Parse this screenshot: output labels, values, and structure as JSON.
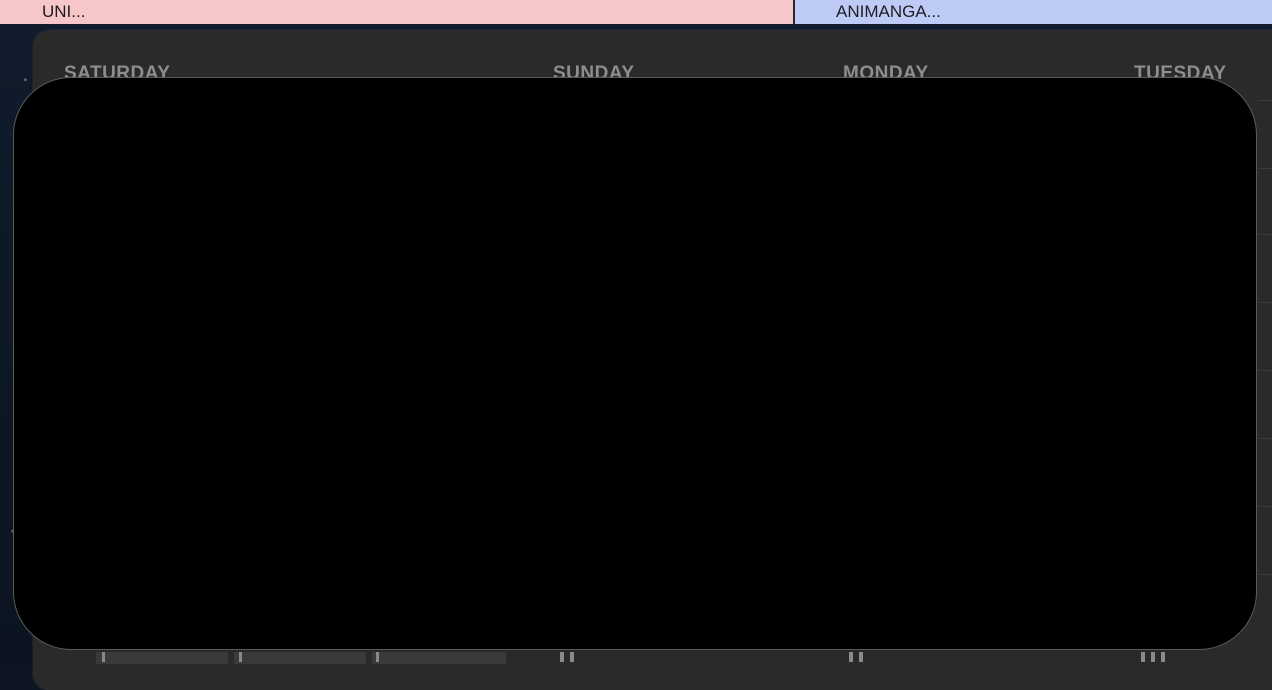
{
  "events": [
    {
      "title": "UNI...",
      "color": "#f6c6c8"
    },
    {
      "title": "ANIMANGA...",
      "color": "#bfcbf7"
    }
  ],
  "calendar": {
    "days": [
      "SATURDAY",
      "SUNDAY",
      "MONDAY",
      "TUESDAY"
    ]
  },
  "overlay": {
    "color": "#000000"
  }
}
